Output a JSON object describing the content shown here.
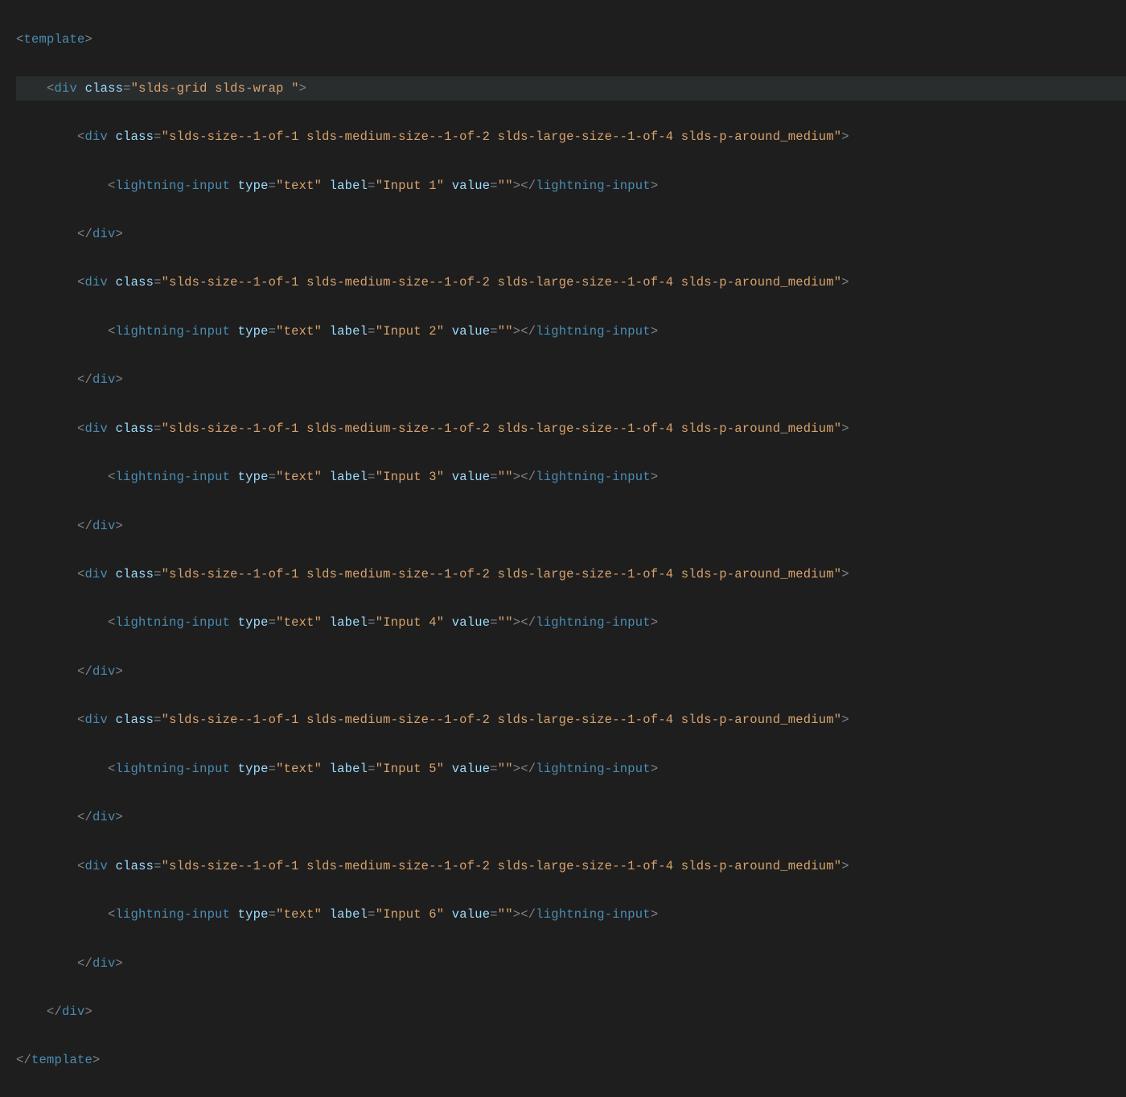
{
  "tags": {
    "template": "template",
    "div": "div",
    "li": "lightning-input"
  },
  "attrs": {
    "class": "class",
    "type": "type",
    "label": "label",
    "value": "value"
  },
  "vals": {
    "gridwrap": "\"slds-grid slds-wrap \"",
    "cell": "\"slds-size--1-of-1 slds-medium-size--1-of-2 slds-large-size--1-of-4 slds-p-around_medium\"",
    "text": "\"text\"",
    "empty": "\"\""
  },
  "labels": {
    "i1": "\"Input 1\"",
    "i2": "\"Input 2\"",
    "i3": "\"Input 3\"",
    "i4": "\"Input 4\"",
    "i5": "\"Input 5\"",
    "i6": "\"Input 6\""
  }
}
